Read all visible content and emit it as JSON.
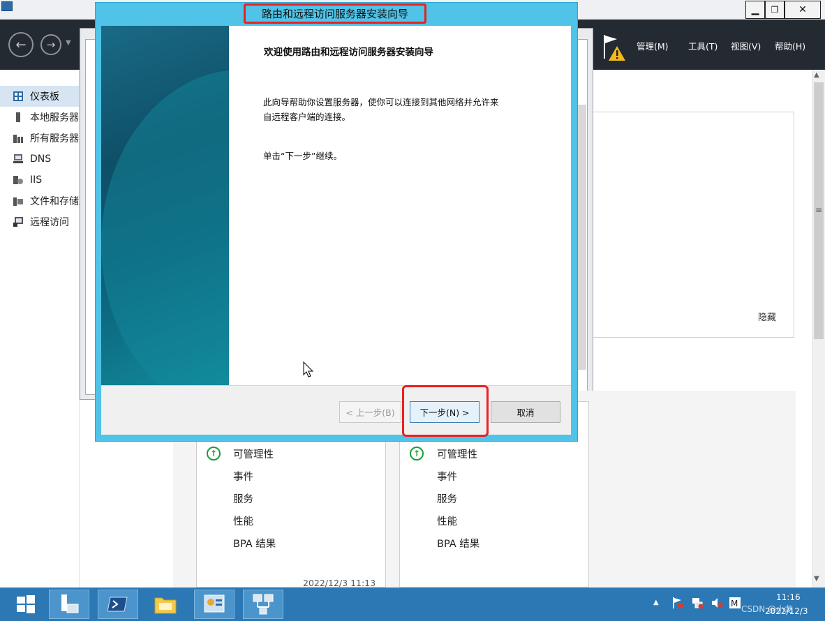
{
  "server_manager": {
    "menu": {
      "manage": "管理(M)",
      "tools": "工具(T)",
      "view": "视图(V)",
      "help": "帮助(H)"
    },
    "sidebar": {
      "items": [
        {
          "label": "仪表板",
          "icon": "dashboard-icon"
        },
        {
          "label": "本地服务器",
          "icon": "local-server-icon"
        },
        {
          "label": "所有服务器",
          "icon": "all-servers-icon"
        },
        {
          "label": "DNS",
          "icon": "dns-icon"
        },
        {
          "label": "IIS",
          "icon": "iis-icon"
        },
        {
          "label": "文件和存储服务",
          "icon": "file-storage-icon"
        },
        {
          "label": "远程访问",
          "icon": "remote-access-icon"
        }
      ]
    },
    "hide_label": "隐藏",
    "tiles": [
      {
        "rows": [
          "可管理性",
          "事件",
          "服务",
          "性能",
          "BPA 结果"
        ],
        "timestamp": "2022/12/3 11:13"
      },
      {
        "rows": [
          "可管理性",
          "事件",
          "服务",
          "性能",
          "BPA 结果"
        ]
      }
    ]
  },
  "dialog": {
    "title": "路由和远程访问服务器安装向导",
    "heading": "欢迎使用路由和远程访问服务器安装向导",
    "desc_line1": "此向导帮助你设置服务器，使你可以连接到其他网络并允许来",
    "desc_line2": "自远程客户端的连接。",
    "continue_text": "单击“下一步”继续。",
    "buttons": {
      "back": "< 上一步(B)",
      "next": "下一步(N) >",
      "cancel": "取消"
    }
  },
  "taskbar": {
    "clock_time": "11:16",
    "clock_date": "2022/12/3",
    "watermark": "CSDN @小龙"
  },
  "colors": {
    "dialog_frame": "#4fc3e8",
    "highlight_red": "#e8211f",
    "taskbar": "#2b78b5",
    "header_dark": "#242a32",
    "ok_green": "#1a9e3a"
  }
}
